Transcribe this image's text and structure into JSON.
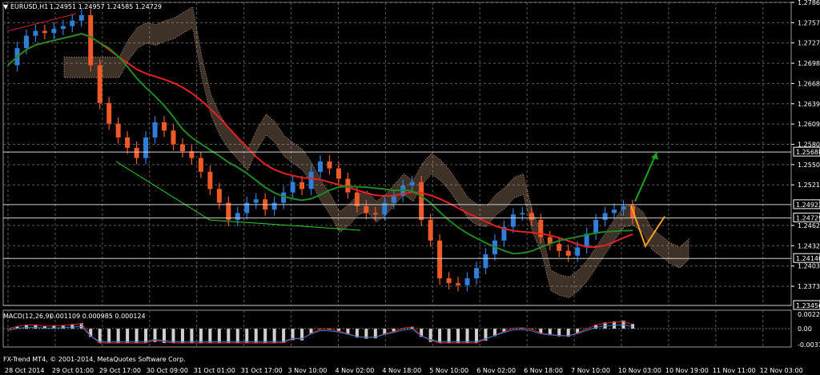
{
  "chart_data": {
    "type": "candlestick",
    "title": "EURUSD,H1",
    "quote": "1.24951 1.24957 1.24585 1.24729",
    "ylim": [
      1.23456,
      1.27865
    ],
    "grid": true,
    "price_ticks": [
      "1.27865",
      "1.27570",
      "1.27275",
      "1.26980",
      "1.26685",
      "1.26390",
      "1.26095",
      "1.25800",
      "1.25505",
      "1.25210",
      "1.24620",
      "1.24325",
      "1.24030",
      "1.23735"
    ],
    "marked_levels": [
      {
        "value": 1.25688,
        "label": "1.25688"
      },
      {
        "value": 1.24923,
        "label": "1.24923"
      },
      {
        "value": 1.24729,
        "label": "1.24729"
      },
      {
        "value": 1.2414,
        "label": "1.24140"
      },
      {
        "value": 1.23456,
        "label": "1.23456"
      }
    ],
    "x_ticks": [
      "28 Oct 2014",
      "29 Oct 01:00",
      "29 Oct 17:00",
      "30 Oct 09:00",
      "31 Oct 01:00",
      "31 Oct 17:00",
      "3 Nov 10:00",
      "4 Nov 02:00",
      "4 Nov 18:00",
      "5 Nov 10:00",
      "6 Nov 02:00",
      "6 Nov 18:00",
      "7 Nov 10:00",
      "10 Nov 03:00",
      "10 Nov 19:00",
      "11 Nov 11:00",
      "12 Nov 03:00"
    ],
    "price_path": [
      1.2695,
      1.272,
      1.2738,
      1.2745,
      1.2742,
      1.2748,
      1.2752,
      1.276,
      1.2768,
      1.2695,
      1.264,
      1.261,
      1.259,
      1.2575,
      1.256,
      1.259,
      1.2612,
      1.26,
      1.258,
      1.257,
      1.256,
      1.254,
      1.2515,
      1.2495,
      1.247,
      1.248,
      1.2495,
      1.25,
      1.2485,
      1.2495,
      1.251,
      1.2525,
      1.2515,
      1.254,
      1.2555,
      1.2545,
      1.253,
      1.251,
      1.249,
      1.248,
      1.2478,
      1.2495,
      1.2505,
      1.252,
      1.2525,
      1.247,
      1.244,
      1.2385,
      1.2378,
      1.2375,
      1.2385,
      1.24,
      1.242,
      1.244,
      1.246,
      1.2478,
      1.248,
      1.247,
      1.2445,
      1.2435,
      1.2425,
      1.2418,
      1.243,
      1.245,
      1.247,
      1.248,
      1.2485,
      1.249,
      1.2473
    ],
    "indicator": {
      "name": "MACD(12,26,9)",
      "values": "0.001109 0.000985 0.000124",
      "ticks": [
        "0.002226",
        "0.00",
        "-0.003784"
      ]
    },
    "projection": {
      "up_to": 1.2568,
      "down_to": 1.2432
    }
  },
  "footer": {
    "copyright": "FX-Trend MT4, © 2001-2014, MetaQuotes Software Corp."
  },
  "colors": {
    "bull": "#2f7fd8",
    "bear": "#f05a28",
    "ma_fast": "#e62020",
    "ma_slow": "#1f8a1f",
    "trend_green": "#27d22a",
    "cloud": "#f7c59f",
    "arrow_up": "#1aa31a",
    "proj": "#f7a11a"
  }
}
